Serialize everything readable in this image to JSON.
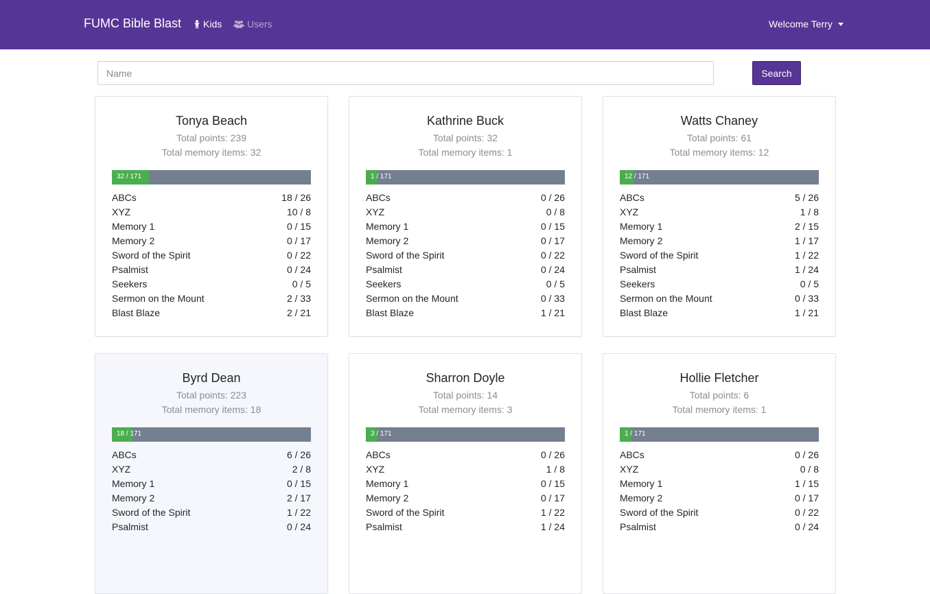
{
  "navbar": {
    "brand": "FUMC Bible Blast",
    "kids_label": "Kids",
    "users_label": "Users",
    "welcome_label": "Welcome Terry"
  },
  "search": {
    "placeholder": "Name",
    "value": "",
    "button_label": "Search"
  },
  "kids": [
    {
      "name": "Tonya Beach",
      "total_points": "Total points: 239",
      "total_memory": "Total memory items: 32",
      "progress_label": "32 / 171",
      "progress_fraction": 0.187,
      "categories": [
        {
          "name": "ABCs",
          "value": "18 / 26"
        },
        {
          "name": "XYZ",
          "value": "10 / 8"
        },
        {
          "name": "Memory 1",
          "value": "0 / 15"
        },
        {
          "name": "Memory 2",
          "value": "0 / 17"
        },
        {
          "name": "Sword of the Spirit",
          "value": "0 / 22"
        },
        {
          "name": "Psalmist",
          "value": "0 / 24"
        },
        {
          "name": "Seekers",
          "value": "0 / 5"
        },
        {
          "name": "Sermon on the Mount",
          "value": "2 / 33"
        },
        {
          "name": "Blast Blaze",
          "value": "2 / 21"
        }
      ]
    },
    {
      "name": "Kathrine Buck",
      "total_points": "Total points: 32",
      "total_memory": "Total memory items: 1",
      "progress_label": "1 / 171",
      "progress_fraction": 0.006,
      "categories": [
        {
          "name": "ABCs",
          "value": "0 / 26"
        },
        {
          "name": "XYZ",
          "value": "0 / 8"
        },
        {
          "name": "Memory 1",
          "value": "0 / 15"
        },
        {
          "name": "Memory 2",
          "value": "0 / 17"
        },
        {
          "name": "Sword of the Spirit",
          "value": "0 / 22"
        },
        {
          "name": "Psalmist",
          "value": "0 / 24"
        },
        {
          "name": "Seekers",
          "value": "0 / 5"
        },
        {
          "name": "Sermon on the Mount",
          "value": "0 / 33"
        },
        {
          "name": "Blast Blaze",
          "value": "1 / 21"
        }
      ]
    },
    {
      "name": "Watts Chaney",
      "total_points": "Total points: 61",
      "total_memory": "Total memory items: 12",
      "progress_label": "12 / 171",
      "progress_fraction": 0.07,
      "categories": [
        {
          "name": "ABCs",
          "value": "5 / 26"
        },
        {
          "name": "XYZ",
          "value": "1 / 8"
        },
        {
          "name": "Memory 1",
          "value": "2 / 15"
        },
        {
          "name": "Memory 2",
          "value": "1 / 17"
        },
        {
          "name": "Sword of the Spirit",
          "value": "1 / 22"
        },
        {
          "name": "Psalmist",
          "value": "1 / 24"
        },
        {
          "name": "Seekers",
          "value": "0 / 5"
        },
        {
          "name": "Sermon on the Mount",
          "value": "0 / 33"
        },
        {
          "name": "Blast Blaze",
          "value": "1 / 21"
        }
      ]
    },
    {
      "name": "Byrd Dean",
      "total_points": "Total points: 223",
      "total_memory": "Total memory items: 18",
      "progress_label": "18 / 171",
      "progress_fraction": 0.105,
      "categories": [
        {
          "name": "ABCs",
          "value": "6 / 26"
        },
        {
          "name": "XYZ",
          "value": "2 / 8"
        },
        {
          "name": "Memory 1",
          "value": "0 / 15"
        },
        {
          "name": "Memory 2",
          "value": "2 / 17"
        },
        {
          "name": "Sword of the Spirit",
          "value": "1 / 22"
        },
        {
          "name": "Psalmist",
          "value": "0 / 24"
        }
      ]
    },
    {
      "name": "Sharron Doyle",
      "total_points": "Total points: 14",
      "total_memory": "Total memory items: 3",
      "progress_label": "3 / 171",
      "progress_fraction": 0.018,
      "categories": [
        {
          "name": "ABCs",
          "value": "0 / 26"
        },
        {
          "name": "XYZ",
          "value": "1 / 8"
        },
        {
          "name": "Memory 1",
          "value": "0 / 15"
        },
        {
          "name": "Memory 2",
          "value": "0 / 17"
        },
        {
          "name": "Sword of the Spirit",
          "value": "1 / 22"
        },
        {
          "name": "Psalmist",
          "value": "1 / 24"
        }
      ]
    },
    {
      "name": "Hollie Fletcher",
      "total_points": "Total points: 6",
      "total_memory": "Total memory items: 1",
      "progress_label": "1 / 171",
      "progress_fraction": 0.006,
      "categories": [
        {
          "name": "ABCs",
          "value": "0 / 26"
        },
        {
          "name": "XYZ",
          "value": "0 / 8"
        },
        {
          "name": "Memory 1",
          "value": "1 / 15"
        },
        {
          "name": "Memory 2",
          "value": "0 / 17"
        },
        {
          "name": "Sword of the Spirit",
          "value": "0 / 22"
        },
        {
          "name": "Psalmist",
          "value": "0 / 24"
        }
      ]
    }
  ],
  "colors": {
    "brand": "#553595",
    "progress_fill": "#4cad50",
    "progress_track": "#74808f"
  },
  "icons": {
    "kids": "child-icon",
    "users": "users-icon"
  }
}
